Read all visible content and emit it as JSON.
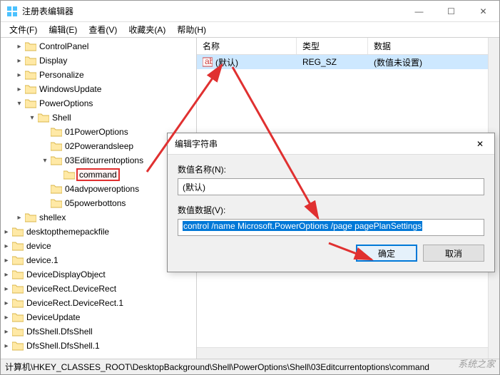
{
  "window": {
    "title": "注册表编辑器",
    "min": "—",
    "max": "☐",
    "close": "✕"
  },
  "menu": {
    "file": "文件(F)",
    "edit": "编辑(E)",
    "view": "查看(V)",
    "favorites": "收藏夹(A)",
    "help": "帮助(H)"
  },
  "tree": {
    "items": [
      "ControlPanel",
      "Display",
      "Personalize",
      "WindowsUpdate",
      "PowerOptions",
      "Shell",
      "01PowerOptions",
      "02Powerandsleep",
      "03Editcurrentoptions",
      "command",
      "04advpoweroptions",
      "05powerbottons",
      "shellex",
      "desktopthemepackfile",
      "device",
      "device.1",
      "DeviceDisplayObject",
      "DeviceRect.DeviceRect",
      "DeviceRect.DeviceRect.1",
      "DeviceUpdate",
      "DfsShell.DfsShell",
      "DfsShell.DfsShell.1"
    ]
  },
  "list": {
    "header": {
      "name": "名称",
      "type": "类型",
      "data": "数据"
    },
    "row": {
      "name": "(默认)",
      "type": "REG_SZ",
      "data": "(数值未设置)"
    }
  },
  "dialog": {
    "title": "编辑字符串",
    "name_label": "数值名称(N):",
    "name_value": "(默认)",
    "data_label": "数值数据(V):",
    "data_value": "control /name Microsoft.PowerOptions /page pagePlanSettings",
    "ok": "确定",
    "cancel": "取消"
  },
  "statusbar": {
    "path": "计算机\\HKEY_CLASSES_ROOT\\DesktopBackground\\Shell\\PowerOptions\\Shell\\03Editcurrentoptions\\command"
  },
  "watermark": "系统之家",
  "colors": {
    "selection": "#cde8ff",
    "accent": "#0078d7",
    "annotation": "#e03030"
  }
}
